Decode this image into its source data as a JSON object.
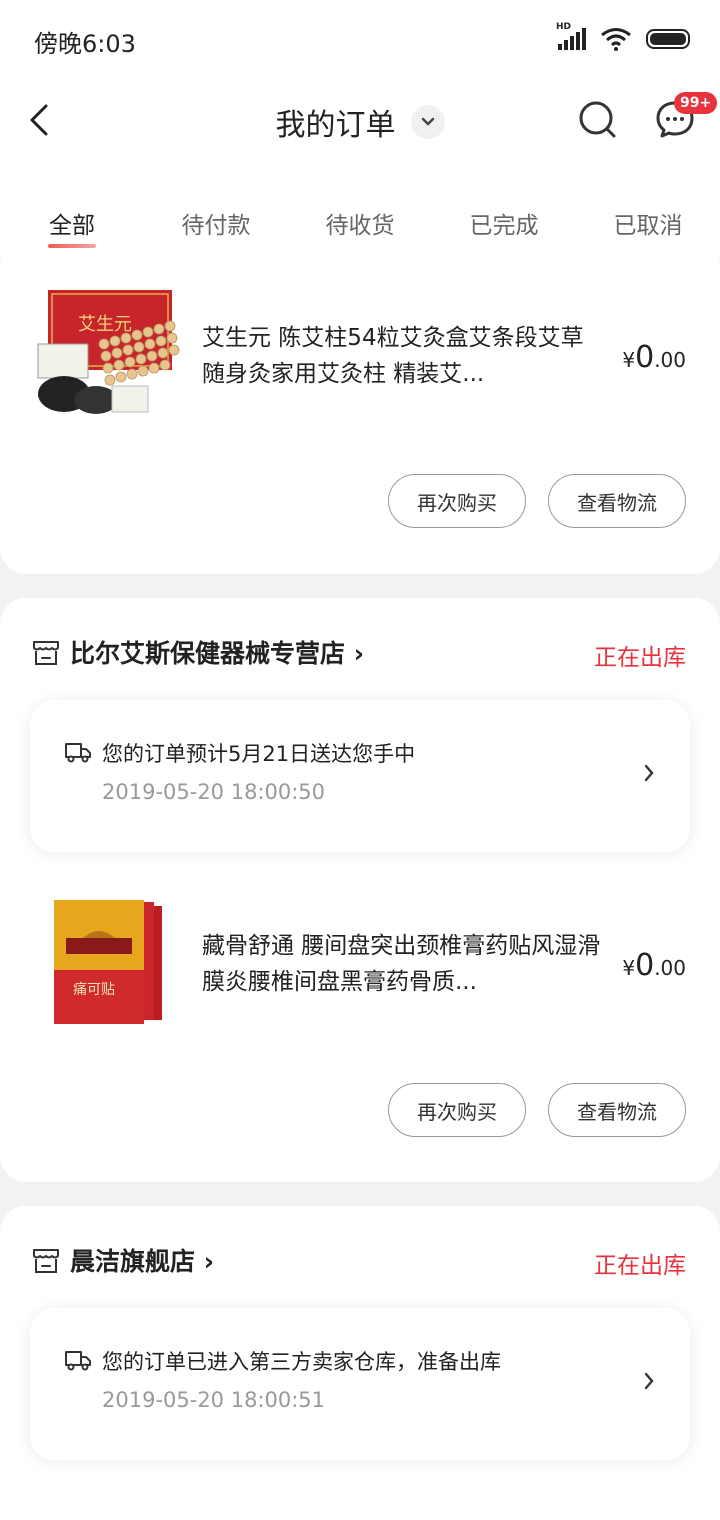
{
  "status_bar": {
    "time": "傍晚6:03",
    "network": "HD"
  },
  "header": {
    "title": "我的订单",
    "message_badge": "99+"
  },
  "tabs": [
    {
      "label": "全部",
      "active": true
    },
    {
      "label": "待付款",
      "active": false
    },
    {
      "label": "待收货",
      "active": false
    },
    {
      "label": "已完成",
      "active": false
    },
    {
      "label": "已取消",
      "active": false
    }
  ],
  "orders": [
    {
      "product": {
        "title": "艾生元  陈艾柱54粒艾灸盒艾条段艾草随身灸家用艾灸柱 精装艾...",
        "price_symbol": "¥",
        "price_int": "0",
        "price_dec": ".00",
        "image_text": "艾生元"
      },
      "buttons": {
        "rebuy": "再次购买",
        "track": "查看物流"
      }
    },
    {
      "store": {
        "name": "比尔艾斯保健器械专营店",
        "chevron": "›",
        "status": "正在出库"
      },
      "logistics": {
        "text": "您的订单预计5月21日送达您手中",
        "time": "2019-05-20 18:00:50"
      },
      "product": {
        "title": "藏骨舒通 腰间盘突出颈椎膏药贴风湿滑膜炎腰椎间盘黑膏药骨质...",
        "price_symbol": "¥",
        "price_int": "0",
        "price_dec": ".00",
        "image_text": "痛可贴"
      },
      "buttons": {
        "rebuy": "再次购买",
        "track": "查看物流"
      }
    },
    {
      "store": {
        "name": "晨洁旗舰店",
        "chevron": "›",
        "status": "正在出库"
      },
      "logistics": {
        "text": "您的订单已进入第三方卖家仓库，准备出库",
        "time": "2019-05-20 18:00:51"
      }
    }
  ],
  "colors": {
    "accent_red": "#e8323c",
    "background": "#f2f2f2",
    "card": "#ffffff"
  }
}
